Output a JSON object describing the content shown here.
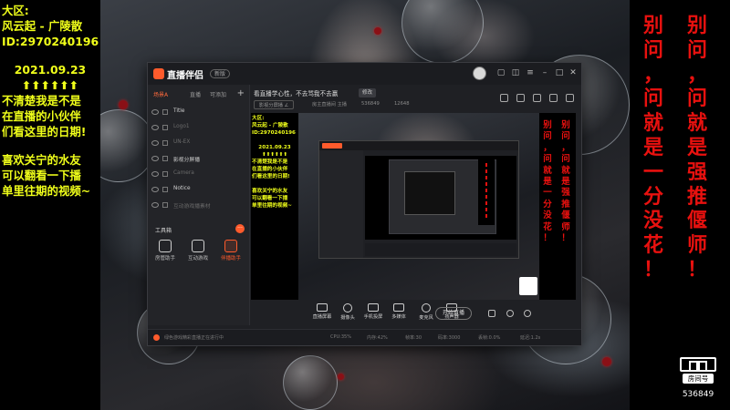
{
  "left_overlay": {
    "lines_top": [
      "大区:",
      "风云起 - 广陵散",
      "ID:2970240196"
    ],
    "date": "2021.09.23",
    "arrows": "⬆⬆⬆⬆⬆⬆",
    "lines_mid": [
      "不清楚我是不是",
      "在直播的小伙伴",
      "们看这里的日期!"
    ],
    "lines_bottom": [
      "喜欢关宁的水友",
      "可以翻看一下播",
      "单里往期的视频~"
    ]
  },
  "right_overlay": {
    "column_1": [
      "别",
      "问",
      "，",
      "问",
      "就",
      "是",
      "一",
      "分",
      "没",
      "花",
      "！"
    ],
    "column_2": [
      "别",
      "问",
      "，",
      "问",
      "就",
      "是",
      "强",
      "推",
      "偃",
      "师",
      "！"
    ],
    "room_label": "房间号",
    "room_number": "536849"
  },
  "app": {
    "title": "直播伴侣",
    "version": "新版",
    "scene_tabs": [
      "场景A",
      "直播",
      "可添加"
    ],
    "scene_add": "+",
    "sources": [
      {
        "label": "Title",
        "dim": false
      },
      {
        "label": "Logo1",
        "dim": true
      },
      {
        "label": "UN-EX",
        "dim": true
      },
      {
        "label": "影视分屏播",
        "dim": false
      },
      {
        "label": "Camera",
        "dim": true
      },
      {
        "label": "Notice",
        "dim": false
      },
      {
        "label": "互动游戏播素材",
        "dim": true
      }
    ],
    "tools_title": "工具箱",
    "tools_more": "···",
    "tools": [
      "房管助手",
      "互动游戏",
      "伴播助手"
    ],
    "room_title": "看直播学心性，不去骂我不去赢",
    "room_edit": "修改",
    "room_tag": "影视分屏播 ∠",
    "room_meta": "房主直播间 主播",
    "room_id": "536849",
    "room_hot": "12648",
    "bottom_buttons": [
      "直播屏幕",
      "摄像头",
      "手机投屏",
      "多媒体",
      "麦克风",
      "扬声器"
    ],
    "start_live": "开始直播",
    "status_text": "绿色游戏精彩直播正在进行中",
    "status_segments": [
      "CPU:35%",
      "内存:42%",
      "帧率:30",
      "码率:3000",
      "丢帧:0.0%",
      "延迟:1.2s"
    ]
  },
  "preview": {
    "left_lines_top": [
      "大区:",
      "风云起 - 广陵散",
      "ID:2970240196"
    ],
    "date": "2021.09.23",
    "arrows": "⬆⬆⬆⬆⬆⬆",
    "left_lines_mid": [
      "不清楚我是不是",
      "在直播的小伙伴",
      "们看这里的日期!"
    ],
    "left_lines_bottom": [
      "喜欢关宁的水友",
      "可以翻看一下播",
      "单里往期的视频~"
    ],
    "right_col_1": [
      "别",
      "问",
      "，",
      "问",
      "就",
      "是",
      "一",
      "分",
      "没",
      "花",
      "！"
    ],
    "right_col_2": [
      "别",
      "问",
      "，",
      "问",
      "就",
      "是",
      "强",
      "推",
      "偃",
      "师",
      "！"
    ]
  },
  "colors": {
    "overlay_yellow": "#f0ff1a",
    "overlay_red": "#e8110f",
    "accent": "#ff5b2c",
    "app_bg": "#1f2024"
  }
}
